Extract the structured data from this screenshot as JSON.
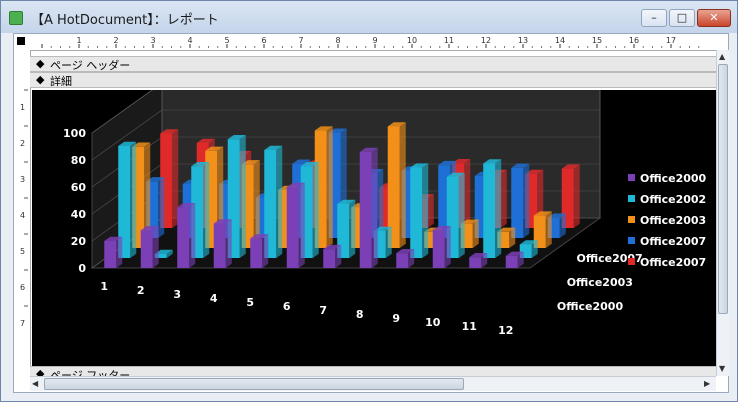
{
  "window": {
    "title": "【A HotDocument】：レポート",
    "minimize_glyph": "–",
    "maximize_glyph": "□",
    "close_glyph": "✕"
  },
  "ruler": {
    "top_labels": [
      "1",
      "2",
      "3",
      "4",
      "5",
      "6",
      "7",
      "8",
      "9",
      "10",
      "11",
      "12",
      "13",
      "14",
      "15",
      "16",
      "17"
    ],
    "left_labels": [
      "1",
      "2",
      "3",
      "4",
      "5",
      "6",
      "7"
    ]
  },
  "sections": {
    "page_header": "ページ ヘッダー",
    "detail": "詳細",
    "page_footer": "ページ フッター"
  },
  "colors": {
    "Office2000": "#7b3fb6",
    "Office2002": "#1fb8d6",
    "Office2003": "#f39019",
    "Office2007a": "#1e70d6",
    "Office2007b": "#e02a2a"
  },
  "chart_data": {
    "type": "bar",
    "categories": [
      "1",
      "2",
      "3",
      "4",
      "5",
      "6",
      "7",
      "8",
      "9",
      "10",
      "11",
      "12"
    ],
    "depth_labels": [
      "Office2007",
      "Office2003",
      "Office2000"
    ],
    "ylim": [
      0,
      100
    ],
    "yticks": [
      0,
      20,
      40,
      60,
      80,
      100
    ],
    "legend_position": "right",
    "series": [
      {
        "name": "Office2000",
        "values": [
          20,
          28,
          45,
          33,
          22,
          60,
          14,
          86,
          11,
          28,
          8,
          9
        ]
      },
      {
        "name": "Office2002",
        "values": [
          83,
          3,
          68,
          88,
          80,
          68,
          40,
          20,
          67,
          60,
          70,
          10
        ]
      },
      {
        "name": "Office2003",
        "values": [
          75,
          0,
          72,
          62,
          43,
          87,
          30,
          90,
          12,
          18,
          12,
          24
        ]
      },
      {
        "name": "Office2007",
        "values": [
          42,
          40,
          40,
          30,
          55,
          78,
          48,
          50,
          54,
          46,
          52,
          15
        ]
      },
      {
        "name": "Office2007",
        "values": [
          70,
          63,
          54,
          0,
          47,
          0,
          30,
          22,
          48,
          40,
          40,
          44
        ]
      }
    ]
  }
}
